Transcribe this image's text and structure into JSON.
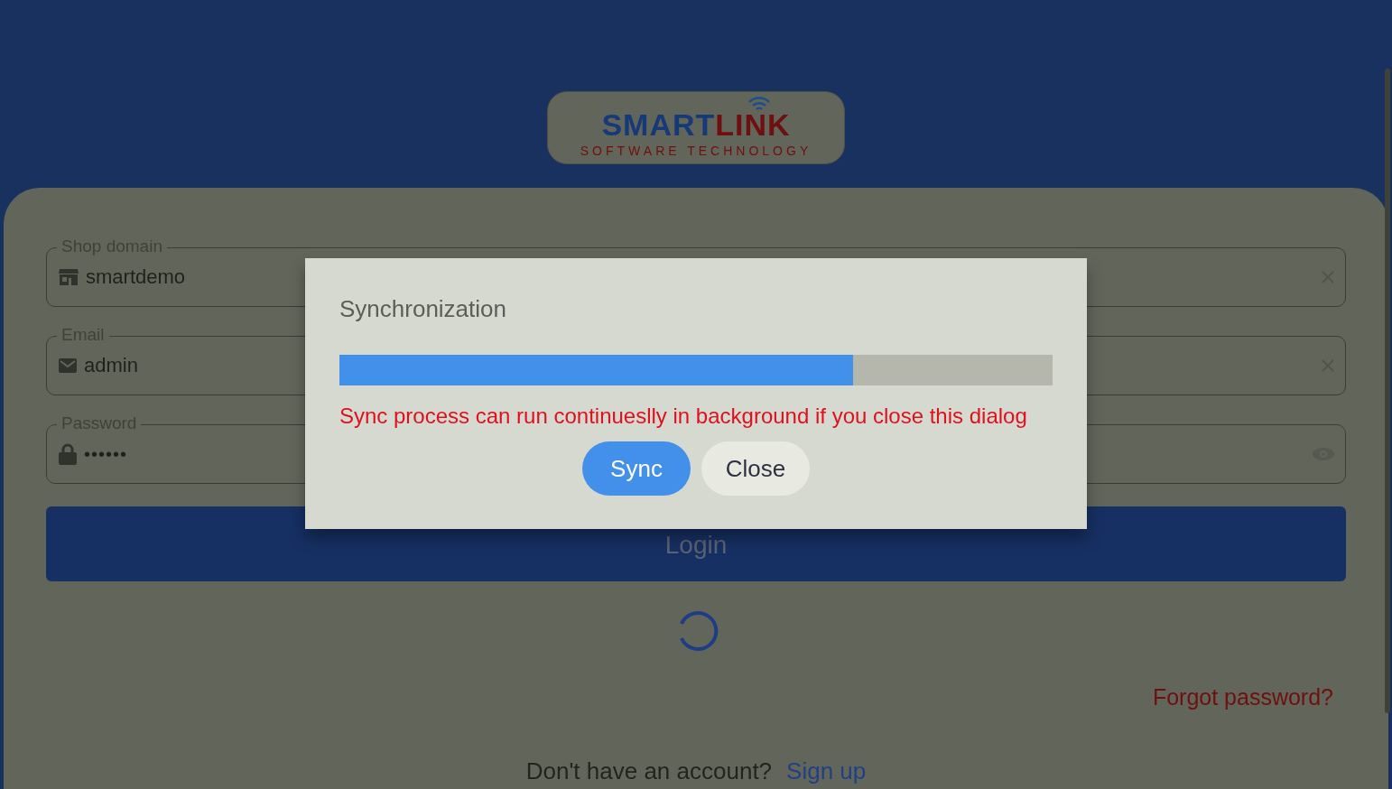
{
  "logo": {
    "brand_a": "SMART",
    "brand_b": "LINK",
    "tagline": "SOFTWARE TECHNOLOGY"
  },
  "fields": [
    {
      "kind": "domain",
      "label": "Shop domain",
      "value": "smartdemo"
    },
    {
      "kind": "email",
      "label": "Email",
      "value": "admin"
    },
    {
      "kind": "password",
      "label": "Password",
      "value": "••••••"
    }
  ],
  "login_button": "Login",
  "loading": true,
  "forgot_password": "Forgot password?",
  "signup": {
    "prompt": "Don't have an account?",
    "link": "Sign up"
  },
  "dialog": {
    "title": "Synchronization",
    "level": 0.72,
    "message": "Sync process can run continueslly in background if you close this dialog",
    "buttons": [
      {
        "label": "Sync",
        "kind": "primary"
      },
      {
        "label": "Close",
        "kind": "secondary"
      }
    ]
  }
}
